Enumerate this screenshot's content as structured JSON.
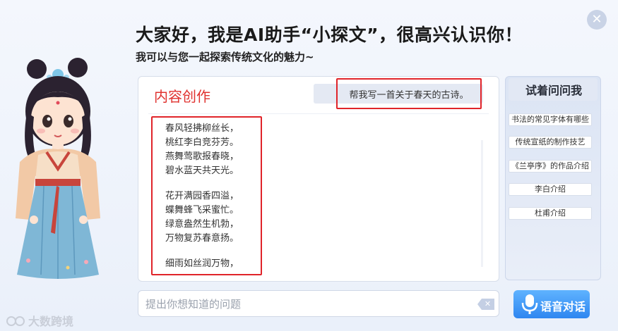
{
  "header": {
    "greeting": "大家好，我是AI助手“小探文”，很高兴认识你！",
    "subtitle": "我可以与您一起探索传统文化的魅力~",
    "close_glyph": "✕"
  },
  "main": {
    "title": "内容创作",
    "prompt": "帮我写一首关于春天的古诗。",
    "poem": {
      "stanza1": [
        "春风轻拂柳丝长，",
        "桃红李白竞芬芳。",
        "燕舞莺歌报春晓，",
        "碧水蓝天共天光。"
      ],
      "stanza2": [
        "花开满园香四溢，",
        "蝶舞蜂飞采蜜忙。",
        "绿意盎然生机勃，",
        "万物复苏春意扬。"
      ],
      "stanza3": [
        "细雨如丝润万物，"
      ]
    }
  },
  "side": {
    "title": "试着问问我",
    "items": [
      "书法的常见字体有哪些",
      "传统宣纸的制作技艺",
      "《兰亭序》的作品介绍",
      "李白介绍",
      "杜甫介绍"
    ]
  },
  "input": {
    "placeholder": "提出你想知道的问题",
    "clear_glyph": "✕"
  },
  "voice": {
    "label": "语音对话",
    "icon": "microphone-icon"
  },
  "watermark": {
    "text": "大数跨境"
  },
  "colors": {
    "accent_red": "#e0242a",
    "title_red": "#e0322f",
    "voice_blue": "#2f86f0"
  }
}
